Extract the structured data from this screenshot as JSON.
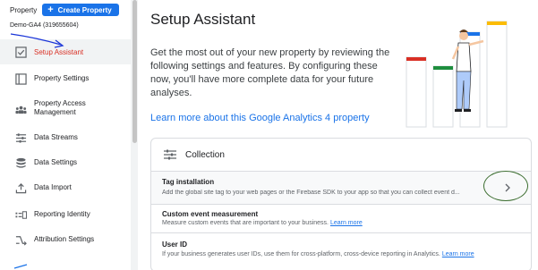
{
  "sidebar": {
    "property_label": "Property",
    "create_property_label": "Create Property",
    "account_id": "Demo-GA4 (319655604)",
    "items": [
      {
        "label": "Setup Assistant",
        "icon": "checkbox-check-icon",
        "active": true
      },
      {
        "label": "Property Settings",
        "icon": "window-icon"
      },
      {
        "label": "Property Access Management",
        "icon": "people-icon"
      },
      {
        "label": "Data Streams",
        "icon": "streams-icon"
      },
      {
        "label": "Data Settings",
        "icon": "database-icon"
      },
      {
        "label": "Data Import",
        "icon": "upload-icon"
      },
      {
        "label": "Reporting Identity",
        "icon": "identity-icon"
      },
      {
        "label": "Attribution Settings",
        "icon": "attribution-icon"
      }
    ]
  },
  "main": {
    "title": "Setup Assistant",
    "intro": "Get the most out of your new property by reviewing the following settings and features. By configuring these now, you'll have more complete data for your future analyses.",
    "learn_more": "Learn more about this Google Analytics 4 property"
  },
  "collection": {
    "title": "Collection",
    "rows": [
      {
        "title": "Tag installation",
        "desc": "Add the global site tag to your web pages or the Firebase SDK to your app so that you can collect event d..."
      },
      {
        "title": "Custom event measurement",
        "desc": "Measure custom events that are important to your business.",
        "link": "Learn more"
      },
      {
        "title": "User ID",
        "desc": "If your business generates user IDs, use them for cross-platform, cross-device reporting in Analytics.",
        "link": "Learn more"
      }
    ]
  },
  "colors": {
    "accent": "#1a73e8",
    "active_text": "#d93025",
    "annotation": "#2e5a2a"
  }
}
